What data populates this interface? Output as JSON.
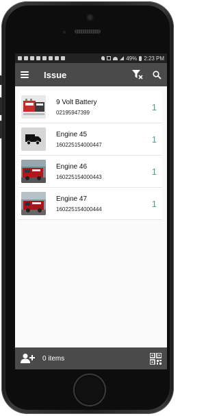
{
  "status_bar": {
    "battery_text": "49%",
    "time": "2:23 PM"
  },
  "app_bar": {
    "title": "Issue",
    "menu_icon": "hamburger-menu-icon",
    "filter_icon": "filter-clear-icon",
    "search_icon": "search-icon"
  },
  "items": [
    {
      "name": "9 Volt Battery",
      "code": "02195947399",
      "qty": "1",
      "thumb": "battery-photo"
    },
    {
      "name": "Engine 45",
      "code": "160225154000447",
      "qty": "1",
      "thumb": "truck-icon"
    },
    {
      "name": "Engine 46",
      "code": "160225154000443",
      "qty": "1",
      "thumb": "fire-engine-photo"
    },
    {
      "name": "Engine 47",
      "code": "160225154000444",
      "qty": "1",
      "thumb": "fire-engine-photo"
    }
  ],
  "bottom_bar": {
    "items_label": "0 items",
    "add_person_icon": "add-person-icon",
    "qr_icon": "qr-code-icon"
  },
  "colors": {
    "app_bar": "#4a4a4a",
    "qty_accent": "#4a9e8f"
  }
}
